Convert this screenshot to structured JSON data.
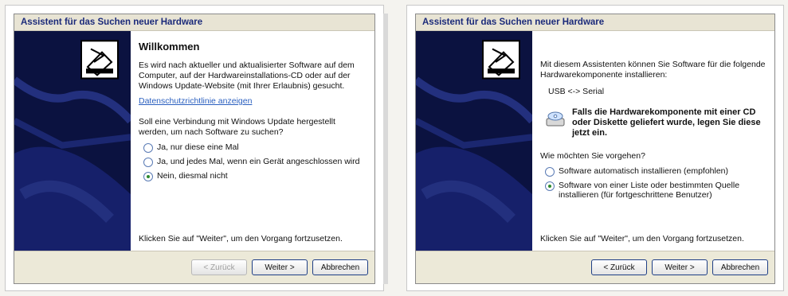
{
  "left_dialog": {
    "title": "Assistent für das Suchen neuer Hardware",
    "heading": "Willkommen",
    "intro": "Es wird nach aktueller und aktualisierter Software auf dem Computer, auf der Hardwareinstallations-CD oder auf der Windows Update-Website (mit Ihrer Erlaubnis) gesucht.",
    "privacy_link": "Datenschutzrichtlinie anzeigen",
    "question": "Soll eine Verbindung mit Windows Update hergestellt werden, um nach Software zu suchen?",
    "options": [
      {
        "label": "Ja, nur diese eine Mal",
        "selected": false
      },
      {
        "label": "Ja, und jedes Mal, wenn ein Gerät angeschlossen wird",
        "selected": false
      },
      {
        "label": "Nein, diesmal nicht",
        "selected": true
      }
    ],
    "footer": "Klicken Sie auf \"Weiter\", um den Vorgang fortzusetzen.",
    "buttons": {
      "back": "< Zurück",
      "next": "Weiter >",
      "cancel": "Abbrechen"
    }
  },
  "right_dialog": {
    "title": "Assistent für das Suchen neuer Hardware",
    "intro": "Mit diesem Assistenten können Sie Software für die folgende Hardwarekomponente installieren:",
    "device": "USB <-> Serial",
    "cd_notice": "Falls die Hardwarekomponente mit einer CD oder Diskette geliefert wurde, legen Sie diese jetzt ein.",
    "question": "Wie möchten Sie vorgehen?",
    "options": [
      {
        "label": "Software automatisch installieren (empfohlen)",
        "selected": false
      },
      {
        "label": "Software von einer Liste oder bestimmten Quelle installieren (für fortgeschrittene Benutzer)",
        "selected": true
      }
    ],
    "footer": "Klicken Sie auf \"Weiter\", um den Vorgang fortzusetzen.",
    "buttons": {
      "back": "< Zurück",
      "next": "Weiter >",
      "cancel": "Abbrechen"
    }
  },
  "colors": {
    "titlebar_text": "#1b2a7a",
    "art_bg": "#0b1240",
    "link": "#2a5fbf"
  },
  "icons": [
    "hardware-wizard-icon",
    "cd-drive-icon",
    "radio-icon"
  ]
}
